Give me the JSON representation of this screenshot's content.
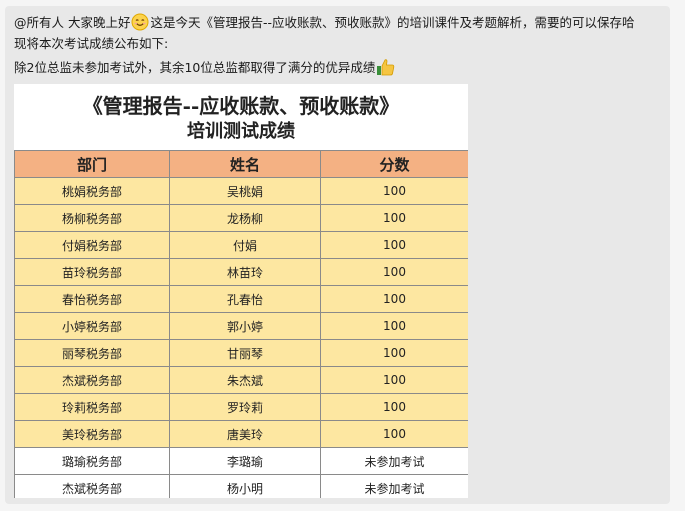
{
  "message": {
    "line1_part1": "@所有人  大家晚上好",
    "line1_part2": "这是今天《管理报告--应收账款、预收账款》的培训课件及考题解析，需要的可以保存哈",
    "line2": "现将本次考试成绩公布如下:",
    "line3": "除2位总监未参加考试外，其余10位总监都取得了满分的优异成绩",
    "emoji_smile": "smile-emoji",
    "emoji_thumbs": "thumbs-up-emoji"
  },
  "sheet": {
    "title": "《管理报告--应收账款、预收账款》",
    "subtitle": "培训测试成绩",
    "headers": [
      "部门",
      "姓名",
      "分数"
    ],
    "rows": [
      {
        "dept": "桃娟税务部",
        "name": "吴桃娟",
        "score": "100"
      },
      {
        "dept": "杨柳税务部",
        "name": "龙杨柳",
        "score": "100"
      },
      {
        "dept": "付娟税务部",
        "name": "付娟",
        "score": "100"
      },
      {
        "dept": "苗玲税务部",
        "name": "林苗玲",
        "score": "100"
      },
      {
        "dept": "春怡税务部",
        "name": "孔春怡",
        "score": "100"
      },
      {
        "dept": "小婷税务部",
        "name": "郭小婷",
        "score": "100"
      },
      {
        "dept": "丽琴税务部",
        "name": "甘丽琴",
        "score": "100"
      },
      {
        "dept": "杰斌税务部",
        "name": "朱杰斌",
        "score": "100"
      },
      {
        "dept": "玲莉税务部",
        "name": "罗玲莉",
        "score": "100"
      },
      {
        "dept": "美玲税务部",
        "name": "唐美玲",
        "score": "100"
      },
      {
        "dept": "璐瑜税务部",
        "name": "李璐瑜",
        "score": "未参加考试"
      },
      {
        "dept": "杰斌税务部",
        "name": "杨小明",
        "score": "未参加考试"
      }
    ],
    "colors": {
      "header": "#f4b183",
      "full_score_row": "#fde7a1",
      "absent_row": "#ffffff"
    }
  }
}
